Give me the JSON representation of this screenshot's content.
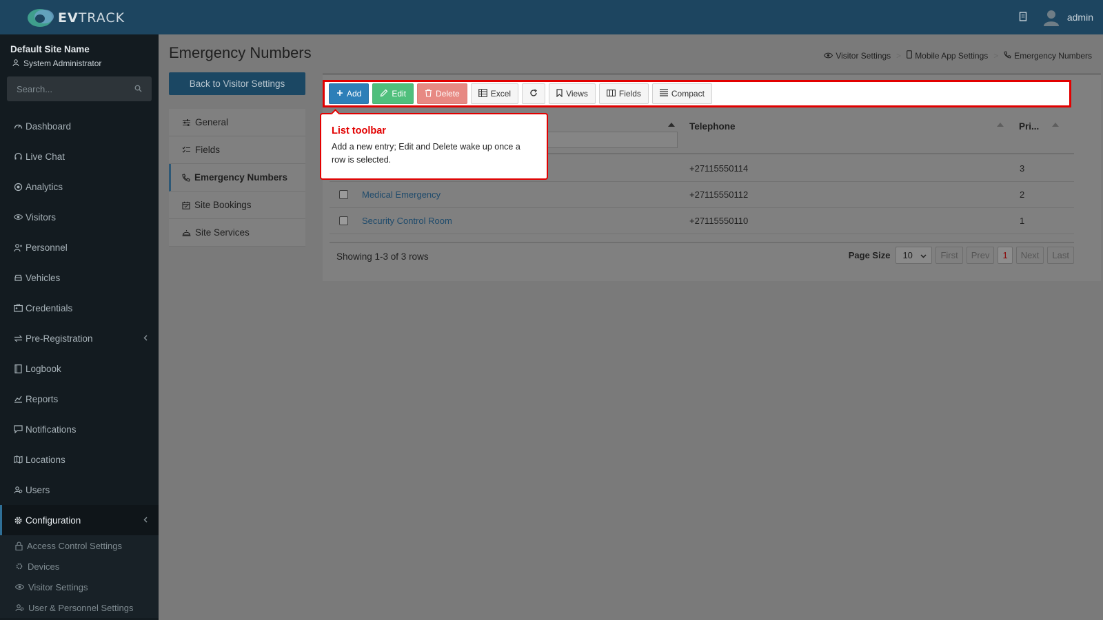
{
  "app": {
    "logo_text_bold": "EV",
    "logo_text": "TRACK",
    "user": "admin"
  },
  "sidebar": {
    "site_name": "Default Site Name",
    "role": "System Administrator",
    "search_placeholder": "Search...",
    "items": [
      {
        "label": "Dashboard",
        "icon": "gauge-icon"
      },
      {
        "label": "Live Chat",
        "icon": "headset-icon"
      },
      {
        "label": "Analytics",
        "icon": "target-icon"
      },
      {
        "label": "Visitors",
        "icon": "eye-icon"
      },
      {
        "label": "Personnel",
        "icon": "person-icon"
      },
      {
        "label": "Vehicles",
        "icon": "car-icon"
      },
      {
        "label": "Credentials",
        "icon": "id-card-icon"
      },
      {
        "label": "Pre-Registration",
        "icon": "exchange-icon"
      },
      {
        "label": "Logbook",
        "icon": "book-icon"
      },
      {
        "label": "Reports",
        "icon": "chart-icon"
      },
      {
        "label": "Notifications",
        "icon": "message-icon"
      },
      {
        "label": "Locations",
        "icon": "map-icon"
      },
      {
        "label": "Users",
        "icon": "users-icon"
      },
      {
        "label": "Configuration",
        "icon": "gear-icon"
      }
    ],
    "sub_items": [
      {
        "label": "Access Control Settings",
        "icon": "lock-icon"
      },
      {
        "label": "Devices",
        "icon": "device-icon"
      },
      {
        "label": "Visitor Settings",
        "icon": "eye-icon"
      },
      {
        "label": "User & Personnel Settings",
        "icon": "users-icon"
      }
    ]
  },
  "page": {
    "title": "Emergency Numbers",
    "breadcrumb": [
      "Visitor Settings",
      "Mobile App Settings",
      "Emergency Numbers"
    ],
    "back_button": "Back to Visitor Settings"
  },
  "settings_menu": [
    {
      "label": "General",
      "icon": "sliders-icon"
    },
    {
      "label": "Fields",
      "icon": "checklist-icon"
    },
    {
      "label": "Emergency Numbers",
      "icon": "phone-icon"
    },
    {
      "label": "Site Bookings",
      "icon": "calendar-icon"
    },
    {
      "label": "Site Services",
      "icon": "bell-icon"
    }
  ],
  "toolbar": {
    "add": "Add",
    "edit": "Edit",
    "delete": "Delete",
    "excel": "Excel",
    "views": "Views",
    "fields": "Fields",
    "compact": "Compact"
  },
  "table": {
    "columns": [
      "Telephone",
      "Pri..."
    ],
    "rows": [
      {
        "name": "",
        "telephone": "+27115550114",
        "priority": "3"
      },
      {
        "name": "Medical Emergency",
        "telephone": "+27115550112",
        "priority": "2"
      },
      {
        "name": "Security Control Room",
        "telephone": "+27115550110",
        "priority": "1"
      }
    ],
    "showing": "Showing 1-3 of 3 rows",
    "page_size_label": "Page Size",
    "page_size": "10",
    "pager": {
      "first": "First",
      "prev": "Prev",
      "current": "1",
      "next": "Next",
      "last": "Last"
    }
  },
  "tooltip": {
    "title": "List toolbar",
    "body": "Add a new entry; Edit and Delete wake up once a row is selected."
  },
  "colors": {
    "topbar": "#1d4560",
    "sidebar": "#131b20",
    "highlight": "#e20000",
    "add": "#2d7fb8",
    "edit": "#4fbf7c",
    "delete": "#e78983"
  }
}
